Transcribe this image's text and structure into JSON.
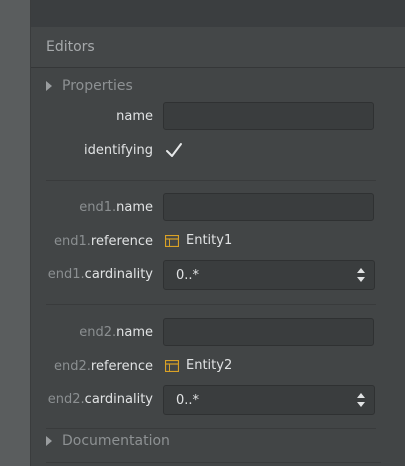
{
  "panel": {
    "title": "Editors"
  },
  "sections": {
    "properties": "Properties",
    "documentation": "Documentation"
  },
  "fields": {
    "name": {
      "label": "name",
      "value": ""
    },
    "identifying": {
      "label": "identifying",
      "checked": true
    },
    "end1_name": {
      "prefix": "end1.",
      "label": "name",
      "value": ""
    },
    "end1_reference": {
      "prefix": "end1.",
      "label": "reference",
      "value": "Entity1",
      "icon": "entity-icon"
    },
    "end1_cardinality": {
      "prefix": "end1.",
      "label": "cardinality",
      "value": "0..*"
    },
    "end2_name": {
      "prefix": "end2.",
      "label": "name",
      "value": ""
    },
    "end2_reference": {
      "prefix": "end2.",
      "label": "reference",
      "value": "Entity2",
      "icon": "entity-icon"
    },
    "end2_cardinality": {
      "prefix": "end2.",
      "label": "cardinality",
      "value": "0..*"
    }
  },
  "colors": {
    "entity_icon": "#d9a126"
  }
}
